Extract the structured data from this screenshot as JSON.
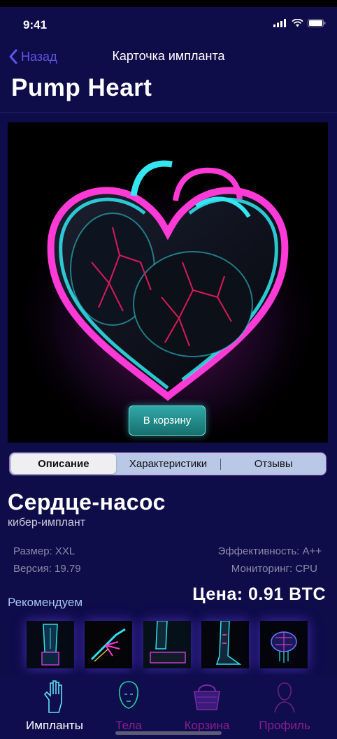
{
  "status": {
    "time": "9:41"
  },
  "nav": {
    "back_label": "Назад",
    "title": "Карточка импланта"
  },
  "page_title": "Pump Heart",
  "hero": {
    "cart_button": "В корзину"
  },
  "tabs": [
    {
      "label": "Описание",
      "active": true
    },
    {
      "label": "Характеристики",
      "active": false
    },
    {
      "label": "Отзывы",
      "active": false
    }
  ],
  "product": {
    "name": "Сердце-насос",
    "subtitle": "кибер-имплант",
    "size": "Размер: XXL",
    "version": "Версия: 19.79",
    "efficiency": "Эффективность: A++",
    "monitoring": "Мониторинг: CPU",
    "price": "Цена: 0.91 BTC"
  },
  "recommend_label": "Рекомендуем",
  "tabbar": [
    {
      "label": "Импланты",
      "icon": "hand-icon",
      "active": true,
      "color": "#ffffff"
    },
    {
      "label": "Тела",
      "icon": "head-icon",
      "active": false,
      "color": "#8a1e8e"
    },
    {
      "label": "Корзина",
      "icon": "basket-icon",
      "active": false,
      "color": "#8a1e8e"
    },
    {
      "label": "Профиль",
      "icon": "profile-icon",
      "active": false,
      "color": "#8a1e8e"
    }
  ],
  "colors": {
    "background": "#0f0c4a",
    "accent": "#5c56e8",
    "neon_pink": "#ff3ad6",
    "neon_cyan": "#34e6f0"
  }
}
